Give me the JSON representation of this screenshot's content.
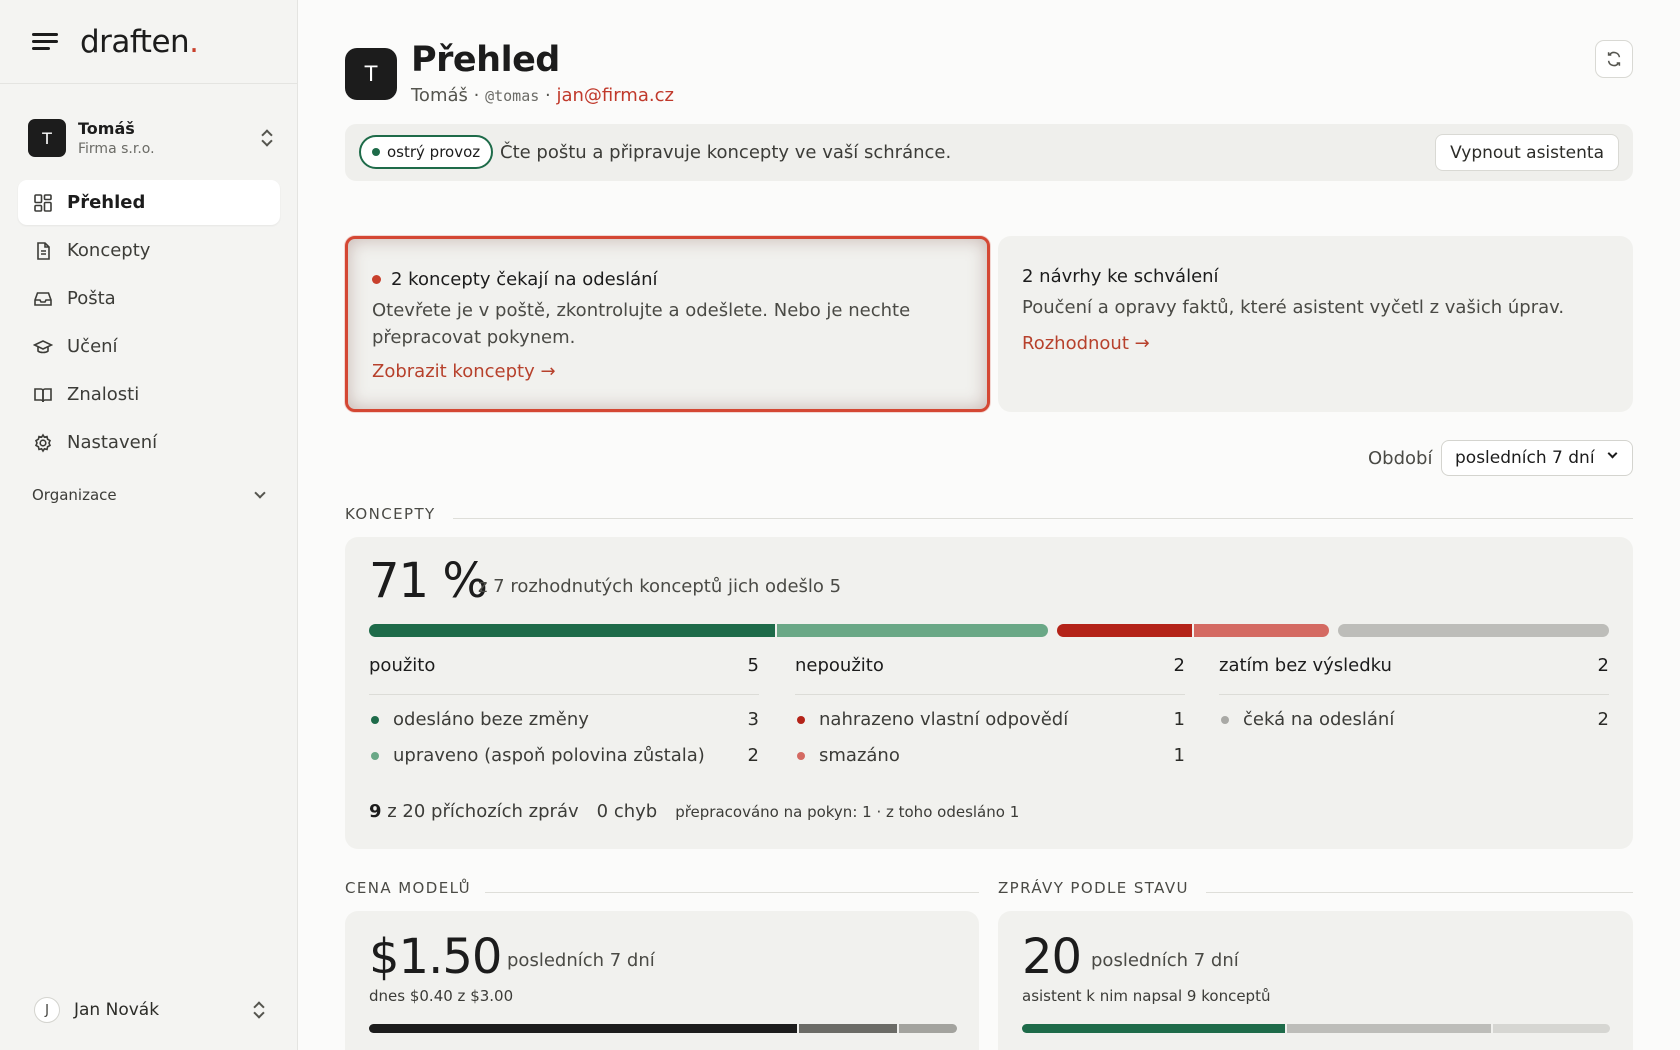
{
  "brand": {
    "logo": "draften",
    "logo_dot": "."
  },
  "org": {
    "initial": "T",
    "name": "Tomáš",
    "sub": "Firma s.r.o."
  },
  "nav": [
    {
      "label": "Přehled",
      "icon": "grid-icon",
      "active": true
    },
    {
      "label": "Koncepty",
      "icon": "document-icon",
      "active": false
    },
    {
      "label": "Pošta",
      "icon": "inbox-icon",
      "active": false
    },
    {
      "label": "Učení",
      "icon": "graduation-cap-icon",
      "active": false
    },
    {
      "label": "Znalosti",
      "icon": "book-icon",
      "active": false
    },
    {
      "label": "Nastavení",
      "icon": "gear-icon",
      "active": false
    }
  ],
  "org_section": {
    "label": "Organizace"
  },
  "user": {
    "initial": "J",
    "name": "Jan Novák"
  },
  "header": {
    "avatar": "T",
    "title": "Přehled",
    "name": "Tomáš",
    "sep": " · ",
    "handle": "@tomas",
    "email": "jan@firma.cz"
  },
  "status": {
    "pill": "ostrý provoz",
    "text": "Čte poštu a připravuje koncepty ve vaší schránce.",
    "button": "Vypnout asistenta"
  },
  "cards": {
    "drafts": {
      "title": "2 koncepty čekají na odeslání",
      "desc": "Otevřete je v poště, zkontrolujte a odešlete. Nebo je nechte přepracovat pokynem.",
      "link": "Zobrazit koncepty →"
    },
    "proposals": {
      "title": "2 návrhy ke schválení",
      "desc": "Poučení a opravy faktů, které asistent vyčetl z vašich úprav.",
      "link": "Rozhodnout →"
    }
  },
  "period": {
    "label": "Období",
    "value": "posledních 7 dní"
  },
  "koncepty": {
    "section": "KONCEPTY",
    "percent": "71 %",
    "subtitle": "z 7 rozhodnutých konceptů jich odešlo 5",
    "bar_values": {
      "sent_unchanged": 3,
      "edited": 2,
      "replaced": 1,
      "deleted": 1,
      "pending": 2
    },
    "columns": [
      {
        "title": "použito",
        "count": "5",
        "rows": [
          {
            "label": "odesláno beze změny",
            "count": "3",
            "color": "#1e6b49"
          },
          {
            "label": "upraveno (aspoň polovina zůstala)",
            "count": "2",
            "color": "#6aa886"
          }
        ]
      },
      {
        "title": "nepoužito",
        "count": "2",
        "rows": [
          {
            "label": "nahrazeno vlastní odpovědí",
            "count": "1",
            "color": "#b42318"
          },
          {
            "label": "smazáno",
            "count": "1",
            "color": "#d46a62"
          }
        ]
      },
      {
        "title": "zatím bez výsledku",
        "count": "2",
        "rows": [
          {
            "label": "čeká na odeslání",
            "count": "2",
            "color": "#a9a9a5"
          }
        ]
      }
    ],
    "footer": {
      "incoming_count": "9",
      "incoming_text": "z 20 příchozích zpráv",
      "errors": "0 chyb",
      "reworked": "přepracováno na pokyn: 1 · z toho odesláno 1"
    }
  },
  "cost": {
    "section": "CENA MODELŮ",
    "value": "$1.50",
    "period": "posledních 7 dní",
    "sub": "dnes $0.40 z $3.00",
    "bar_values": [
      1.1,
      0.25,
      0.15
    ]
  },
  "messages": {
    "section": "ZPRÁVY PODLE STAVU",
    "value": "20",
    "period": "posledních 7 dní",
    "sub": "asistent k nim napsal 9 konceptů",
    "bar_values": [
      9,
      7,
      4
    ]
  },
  "colors": {
    "accent_red": "#c8402c",
    "green_dark": "#1e6b49",
    "green_light": "#6aa886",
    "red_dark": "#b42318",
    "red_light": "#d46a62",
    "gray": "#a9a9a5"
  }
}
